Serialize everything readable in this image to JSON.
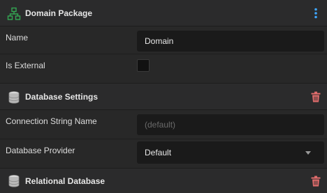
{
  "domain_package": {
    "title": "Domain Package",
    "icon": "hierarchy-icon",
    "menu_icon": "kebab-menu-icon",
    "accent_color": "#34a853",
    "menu_color": "#3ea6ff",
    "fields": {
      "name_label": "Name",
      "name_value": "Domain",
      "is_external_label": "Is External",
      "is_external_checked": false
    }
  },
  "database_settings": {
    "title": "Database Settings",
    "icon": "database-icon",
    "delete_icon": "trash-icon",
    "delete_color": "#e06c6c",
    "fields": {
      "connection_string_label": "Connection String Name",
      "connection_string_value": "",
      "connection_string_placeholder": "(default)",
      "provider_label": "Database Provider",
      "provider_selected": "Default"
    }
  },
  "relational_database": {
    "title": "Relational Database",
    "icon": "database-icon",
    "delete_icon": "trash-icon"
  }
}
